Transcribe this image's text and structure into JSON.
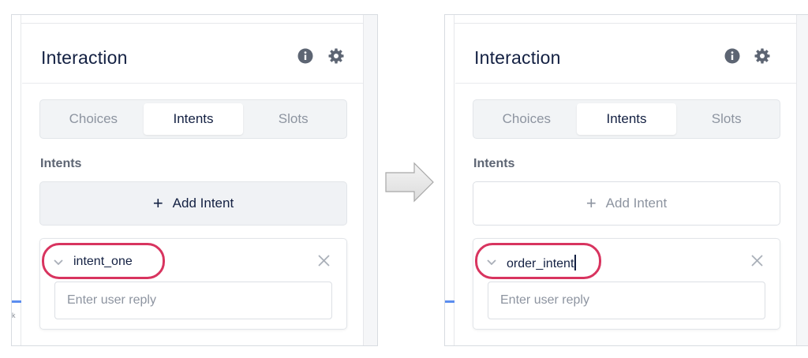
{
  "colors": {
    "accent_highlight": "#d8345f",
    "title_text": "#132042",
    "muted_text": "#8d94a0"
  },
  "before": {
    "panel_title": "Interaction",
    "header_icons": [
      "info-icon",
      "gear-icon"
    ],
    "tabs": [
      {
        "label": "Choices"
      },
      {
        "label": "Intents",
        "active": true
      },
      {
        "label": "Slots"
      }
    ],
    "section_label": "Intents",
    "add_button_label": "Add Intent",
    "intent": {
      "name": "intent_one",
      "reply_placeholder": "Enter user reply"
    }
  },
  "after": {
    "panel_title": "Interaction",
    "header_icons": [
      "info-icon",
      "gear-icon"
    ],
    "tabs": [
      {
        "label": "Choices"
      },
      {
        "label": "Intents",
        "active": true
      },
      {
        "label": "Slots"
      }
    ],
    "section_label": "Intents",
    "add_button_label": "Add Intent",
    "intent": {
      "name": "order_intent",
      "reply_placeholder": "Enter user reply"
    }
  },
  "transition_arrow": "right-arrow-icon"
}
